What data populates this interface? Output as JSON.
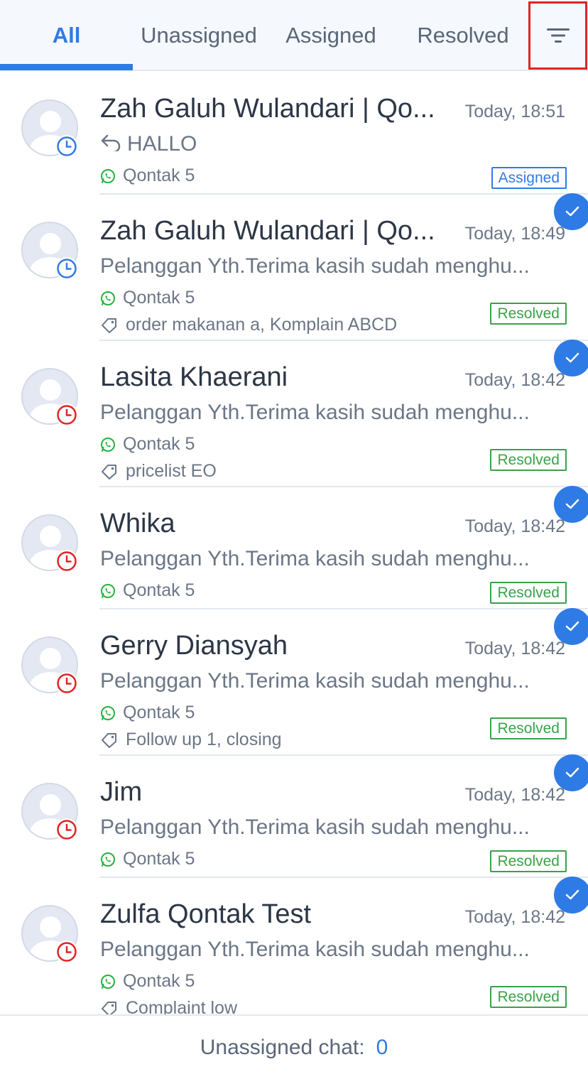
{
  "tabs": [
    {
      "label": "All",
      "active": true
    },
    {
      "label": "Unassigned",
      "active": false
    },
    {
      "label": "Assigned",
      "active": false
    },
    {
      "label": "Resolved",
      "active": false
    }
  ],
  "filter_icon": "filter-icon",
  "conversations": [
    {
      "name": "Zah Galuh Wulandari | Qo...",
      "time": "Today, 18:51",
      "message": "HALLO",
      "has_reply_icon": true,
      "channel": "Qontak 5",
      "tags": "",
      "status": "Assigned",
      "clock_color": "#2f7be5",
      "show_check": false
    },
    {
      "name": "Zah Galuh Wulandari | Qo...",
      "time": "Today, 18:49",
      "message": "Pelanggan Yth.Terima kasih sudah menghu...",
      "has_reply_icon": false,
      "channel": "Qontak 5",
      "tags": "order makanan a, Komplain ABCD",
      "status": "Resolved",
      "clock_color": "#2f7be5",
      "show_check": true
    },
    {
      "name": "Lasita Khaerani",
      "time": "Today, 18:42",
      "message": "Pelanggan Yth.Terima kasih sudah menghu...",
      "has_reply_icon": false,
      "channel": "Qontak 5",
      "tags": "pricelist EO",
      "status": "Resolved",
      "clock_color": "#e02424",
      "show_check": true
    },
    {
      "name": "Whika",
      "time": "Today, 18:42",
      "message": "Pelanggan Yth.Terima kasih sudah menghu...",
      "has_reply_icon": false,
      "channel": "Qontak 5",
      "tags": "",
      "status": "Resolved",
      "clock_color": "#e02424",
      "show_check": true
    },
    {
      "name": "Gerry Diansyah",
      "time": "Today, 18:42",
      "message": "Pelanggan Yth.Terima kasih sudah menghu...",
      "has_reply_icon": false,
      "channel": "Qontak 5",
      "tags": "Follow up 1, closing",
      "status": "Resolved",
      "clock_color": "#e02424",
      "show_check": true
    },
    {
      "name": "Jim",
      "time": "Today, 18:42",
      "message": "Pelanggan Yth.Terima kasih sudah menghu...",
      "has_reply_icon": false,
      "channel": "Qontak 5",
      "tags": "",
      "status": "Resolved",
      "clock_color": "#e02424",
      "show_check": true
    },
    {
      "name": "Zulfa Qontak Test",
      "time": "Today, 18:42",
      "message": "Pelanggan Yth.Terima kasih sudah menghu...",
      "has_reply_icon": false,
      "channel": "Qontak 5",
      "tags": "Complaint low",
      "status": "Resolved",
      "clock_color": "#e02424",
      "show_check": true
    }
  ],
  "footer": {
    "label": "Unassigned chat:",
    "count": "0"
  },
  "colors": {
    "accent": "#2f7be5",
    "resolved": "#3aa14a",
    "overdue": "#e02424",
    "whatsapp": "#25b33f",
    "highlight_box": "#e02424"
  }
}
